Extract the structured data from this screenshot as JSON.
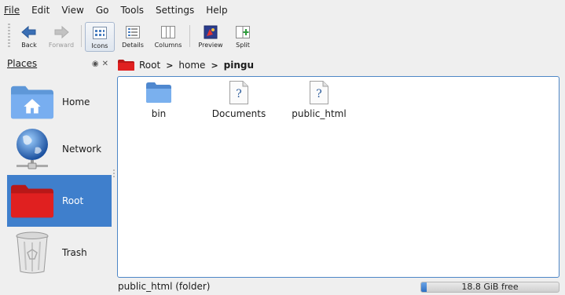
{
  "menu": [
    "File",
    "Edit",
    "View",
    "Go",
    "Tools",
    "Settings",
    "Help"
  ],
  "toolbar": {
    "back": "Back",
    "forward": "Forward",
    "icons": "Icons",
    "details": "Details",
    "columns": "Columns",
    "preview": "Preview",
    "split": "Split"
  },
  "places": {
    "title": "Places",
    "items": [
      {
        "label": "Home",
        "icon": "home-folder-icon"
      },
      {
        "label": "Network",
        "icon": "network-globe-icon"
      },
      {
        "label": "Root",
        "icon": "red-folder-icon",
        "selected": true
      },
      {
        "label": "Trash",
        "icon": "trash-icon"
      }
    ]
  },
  "breadcrumb": {
    "items": [
      "Root",
      "home",
      "pingu"
    ],
    "separator": ">"
  },
  "files": [
    {
      "name": "bin",
      "icon": "folder-icon"
    },
    {
      "name": "Documents",
      "icon": "unknown-file-icon"
    },
    {
      "name": "public_html",
      "icon": "unknown-file-icon"
    }
  ],
  "status": {
    "text": "public_html (folder)",
    "free_space": "18.8 GiB free",
    "used_fraction": 0.04
  },
  "colors": {
    "selection": "#3f7fcc",
    "view_border": "#4d86c6",
    "root_folder": "#e02020"
  }
}
